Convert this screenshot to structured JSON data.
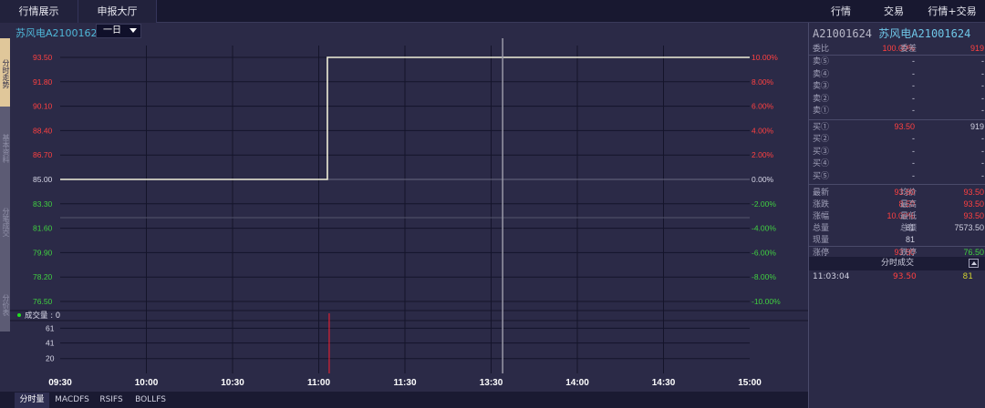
{
  "topbar": {
    "tab_market": "行情展示",
    "tab_order": "申报大厅",
    "tab_quote": "行情",
    "tab_trade": "交易",
    "tab_quote_trade": "行情+交易"
  },
  "left_tabs": [
    "分时走势",
    "基本资料",
    "分笔成交",
    "分价表"
  ],
  "chart_header": {
    "title": "苏风电A21001624",
    "period": "一日"
  },
  "volume_label": "成交量 : 0",
  "bottom_tabs": [
    "分时量",
    "MACDFS",
    "RSIFS",
    "BOLLFS"
  ],
  "colors": {
    "background": "#2b2a47",
    "price_line": "#f0eed8",
    "up": "#ff4040",
    "down": "#40d040",
    "accent": "#4fb7d8",
    "cursor": "#9a9aa8",
    "volume_bar": "#ff2030"
  },
  "chart_data": {
    "type": "line",
    "price_ticks": [
      "93.50",
      "91.80",
      "90.10",
      "88.40",
      "86.70",
      "85.00",
      "83.30",
      "81.60",
      "79.90",
      "78.20",
      "76.50"
    ],
    "pct_ticks": [
      "10.00%",
      "8.00%",
      "6.00%",
      "4.00%",
      "2.00%",
      "0.00%",
      "-2.00%",
      "-4.00%",
      "-6.00%",
      "-8.00%",
      "-10.00%"
    ],
    "time_ticks": [
      "09:30",
      "10:00",
      "10:30",
      "11:00",
      "11:30",
      "13:30",
      "14:00",
      "14:30",
      "15:00"
    ],
    "ylim": [
      76.5,
      93.5
    ],
    "prev_close": 85.0,
    "session_minutes": 240,
    "series": [
      {
        "values": [
          [
            0,
            85.0
          ],
          [
            93,
            85.0
          ],
          [
            93,
            93.5
          ],
          [
            240,
            93.5
          ]
        ]
      }
    ],
    "volume_ticks": [
      "61",
      "41",
      "20"
    ],
    "volume_ylim": [
      0,
      70
    ],
    "volume_bars": [
      [
        93,
        81
      ]
    ],
    "cursor_minute": 154
  },
  "right_panel": {
    "code": "A21001624",
    "name": "苏风电A21001624",
    "ratio_label": "委比",
    "ratio_value": "100.00%",
    "diff_label": "委差",
    "diff_value": "919",
    "sells": [
      {
        "label": "卖⑤",
        "price": "-",
        "qty": "-"
      },
      {
        "label": "卖④",
        "price": "-",
        "qty": "-"
      },
      {
        "label": "卖③",
        "price": "-",
        "qty": "-"
      },
      {
        "label": "卖②",
        "price": "-",
        "qty": "-"
      },
      {
        "label": "卖①",
        "price": "-",
        "qty": "-"
      }
    ],
    "buys": [
      {
        "label": "买①",
        "price": "93.50",
        "qty": "919"
      },
      {
        "label": "买②",
        "price": "-",
        "qty": "-"
      },
      {
        "label": "买③",
        "price": "-",
        "qty": "-"
      },
      {
        "label": "买④",
        "price": "-",
        "qty": "-"
      },
      {
        "label": "买⑤",
        "price": "-",
        "qty": "-"
      }
    ],
    "stats": [
      {
        "l1": "最新",
        "v1": "93.50",
        "l2": "均价",
        "v2": "93.50",
        "c1": "red",
        "c2": "red"
      },
      {
        "l1": "涨跌",
        "v1": "8.50",
        "l2": "最高",
        "v2": "93.50",
        "c1": "red",
        "c2": "red"
      },
      {
        "l1": "涨幅",
        "v1": "10.00%",
        "l2": "最低",
        "v2": "93.50",
        "c1": "red",
        "c2": "red"
      },
      {
        "l1": "总量",
        "v1": "81",
        "l2": "总额",
        "v2": "7573.50",
        "c1": "",
        "c2": ""
      },
      {
        "l1": "现量",
        "v1": "81",
        "l2": "",
        "v2": "",
        "c1": "",
        "c2": ""
      }
    ],
    "limit_row": {
      "l1": "涨停",
      "v1": "93.50",
      "l2": "跌停",
      "v2": "76.50"
    },
    "trade_header": "分时成交",
    "trades": [
      {
        "time": "11:03:04",
        "price": "93.50",
        "qty": "81"
      }
    ]
  }
}
